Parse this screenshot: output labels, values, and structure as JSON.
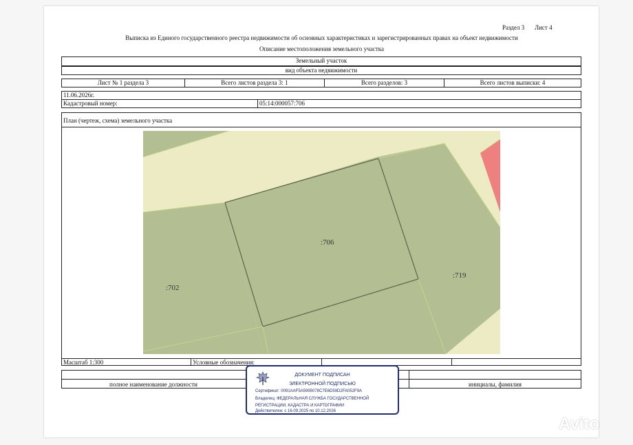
{
  "header": {
    "section": "Раздел 3",
    "sheet": "Лист 4",
    "title": "Выписка из Единого государственного реестра недвижимости об основных характеристиках и зарегистрированных правах на объект недвижимости",
    "subtitle": "Описание местоположения земельного участка"
  },
  "object": {
    "type": "Земельный участок",
    "type_caption": "вид объекта недвижимости"
  },
  "sheets": {
    "sheet_of_section": "Лист № 1 раздела 3",
    "section_sheets_total": "Всего листов раздела 3: 1",
    "sections_total": "Всего разделов: 3",
    "extract_sheets_total": "Всего листов выписки: 4"
  },
  "date": "11.06.2026г.",
  "cadastral": {
    "label": "Кадастровый номер:",
    "value": "05:14:000057:706"
  },
  "plan": {
    "title": "План (чертеж, схема) земельного участка",
    "labels": {
      "main": ":706",
      "left": ":702",
      "right": ":719"
    }
  },
  "footer": {
    "scale": "Масштаб 1:300",
    "legend": "Условные обозначения:",
    "position_caption": "полное наименование должности",
    "name_caption": "инициалы, фамилия"
  },
  "stamp": {
    "line1": "ДОКУМЕНТ ПОДПИСАН",
    "line2": "ЭЛЕКТРОННОЙ ПОДПИСЬЮ",
    "cert": "Сертификат: 0091AAF5A5995078C7E6D59D2FA052F9A",
    "owner1": "Владелец: ФЕДЕРАЛЬНАЯ СЛУЖБА ГОСУДАРСТВЕННОЙ",
    "owner2": "РЕГИСТРАЦИИ, КАДАСТРА И КАРТОГРАФИИ",
    "valid": "Действителен: с 16.09.2025 по 10.12.2026"
  },
  "watermark": "Avito",
  "colors": {
    "parcel_green": "#b3bf92",
    "road_beige": "#ecebc3",
    "red_zone": "#ee8080",
    "stamp_blue": "#1f2d6e"
  }
}
